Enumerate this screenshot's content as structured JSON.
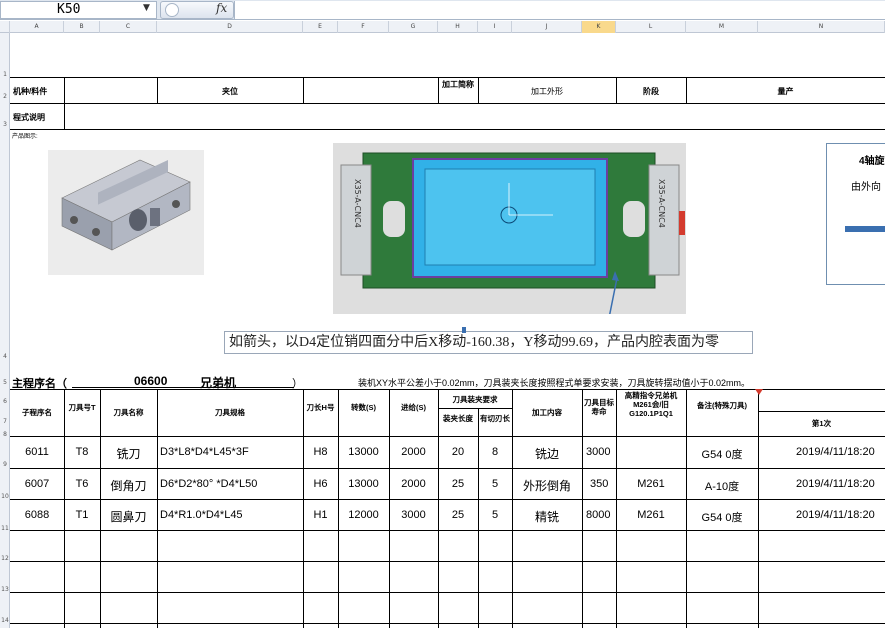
{
  "formula_bar": {
    "name_box": "K50",
    "fx_label": "fx",
    "formula": ""
  },
  "columns": [
    "A",
    "B",
    "C",
    "D",
    "E",
    "F",
    "G",
    "H",
    "I",
    "J",
    "K",
    "L",
    "M",
    "N"
  ],
  "rows": [
    "1",
    "2",
    "3",
    "4",
    "5",
    "6",
    "7",
    "8",
    "9",
    "10",
    "11",
    "12",
    "13",
    "14"
  ],
  "header": {
    "machine_label": "机种/料件",
    "fixture_label": "夹位",
    "process_label": "加工简称",
    "process_value": "加工外形",
    "stage_label": "阶段",
    "stage_value": "量产",
    "program_note_label": "程式说明",
    "product_view_label": "产品图示:"
  },
  "callout_text": "如箭头，以D4定位销四面分中后X移动-160.38，Y移动99.69，产品内腔表面为零",
  "note_box": {
    "line1": "4轴旋",
    "line2": "由外向",
    "line3": ""
  },
  "fixture_marks": {
    "left": "X35-A-CNC4",
    "right": "X35-A-CNC4"
  },
  "main_program": {
    "label": "主程序名（",
    "number": "06600",
    "machine": "兄弟机",
    "close": "）",
    "note": "装机XY水平公差小于0.02mm，刀具装夹长度按照程式单要求安装，刀具旋转摆动值小于0.02mm。"
  },
  "table": {
    "headers": {
      "sub_program": "子程序名",
      "tool_no": "刀具号T",
      "tool_name": "刀具名称",
      "tool_spec": "刀具规格",
      "length_h": "刀长H号",
      "speed": "转数(S)",
      "feed": "进给(S)",
      "clamp_req": "刀具装夹要求",
      "clamp_len": "装夹长度",
      "cut_len": "有切刃长",
      "content": "加工内容",
      "life": "刀具目标寿命",
      "brother": "高精指令兄弟机M261会/旧G120.1P1Q1",
      "remark": "备注(特殊刀具)",
      "first": "第1次"
    },
    "rows": [
      {
        "prog": "6011",
        "t": "T8",
        "name": "铣刀",
        "spec": "D3*L8*D4*L45*3F",
        "h": "H8",
        "s": "13000",
        "f": "2000",
        "clamp": "20",
        "cut": "8",
        "content": "铣边",
        "life": "3000",
        "cmd": "",
        "remark": "G54 0度",
        "time": "2019/4/11/18:20"
      },
      {
        "prog": "6007",
        "t": "T6",
        "name": "倒角刀",
        "spec": "D6*D2*80° *D4*L50",
        "h": "H6",
        "s": "13000",
        "f": "2000",
        "clamp": "25",
        "cut": "5",
        "content": "外形倒角",
        "life": "350",
        "cmd": "M261",
        "remark": "A-10度",
        "time": "2019/4/11/18:20"
      },
      {
        "prog": "6088",
        "t": "T1",
        "name": "圆鼻刀",
        "spec": "D4*R1.0*D4*L45",
        "h": "H1",
        "s": "12000",
        "f": "3000",
        "clamp": "25",
        "cut": "5",
        "content": "精铣",
        "life": "8000",
        "cmd": "M261",
        "remark": "G54 0度",
        "time": "2019/4/11/18:20"
      }
    ]
  }
}
